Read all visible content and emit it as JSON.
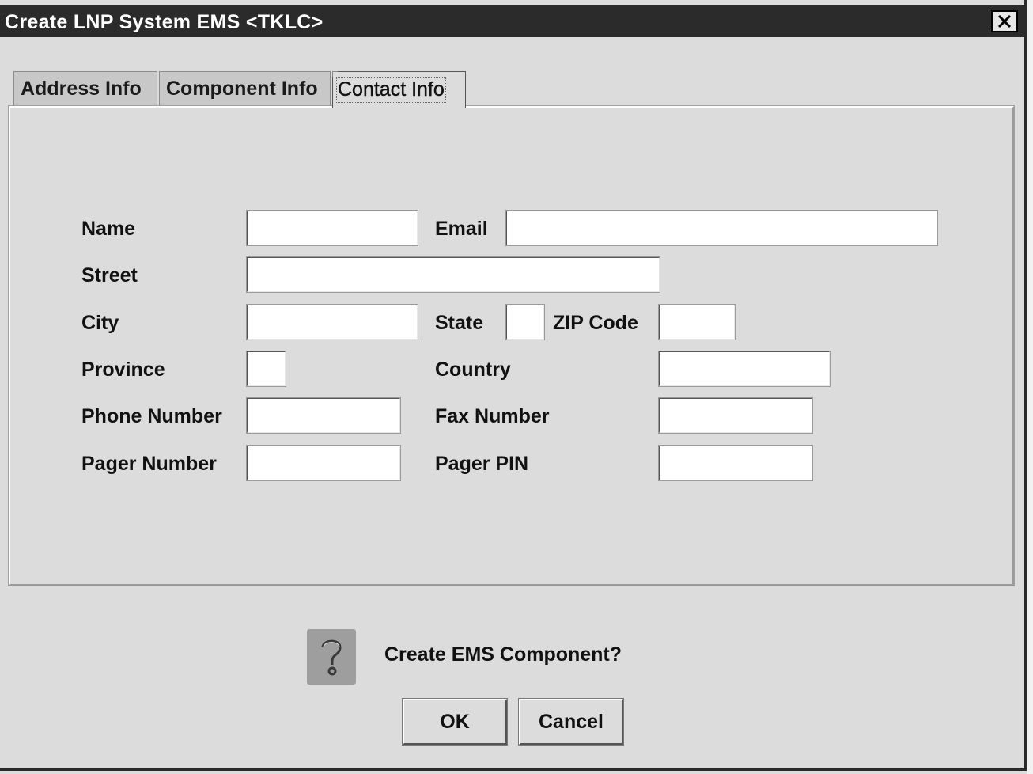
{
  "window": {
    "title": "Create LNP System EMS <TKLC>",
    "close_icon": "close-icon"
  },
  "tabs": [
    {
      "label": "Address Info",
      "selected": false
    },
    {
      "label": "Component Info",
      "selected": false
    },
    {
      "label": "Contact Info",
      "selected": true
    }
  ],
  "form": {
    "name_label": "Name",
    "name_value": "",
    "email_label": "Email",
    "email_value": "",
    "street_label": "Street",
    "street_value": "",
    "city_label": "City",
    "city_value": "",
    "state_label": "State",
    "state_value": "",
    "zip_label": "ZIP Code",
    "zip_value": "",
    "province_label": "Province",
    "province_value": "",
    "country_label": "Country",
    "country_value": "",
    "phone_label": "Phone Number",
    "phone_value": "",
    "fax_label": "Fax Number",
    "fax_value": "",
    "pager_label": "Pager Number",
    "pager_value": "",
    "pager_pin_label": "Pager PIN",
    "pager_pin_value": ""
  },
  "confirm": {
    "icon": "question-icon",
    "message": "Create EMS Component?",
    "ok_label": "OK",
    "cancel_label": "Cancel"
  },
  "colors": {
    "titlebar": "#2b2b2b",
    "background": "#dcdcdc",
    "field": "#ffffff"
  }
}
